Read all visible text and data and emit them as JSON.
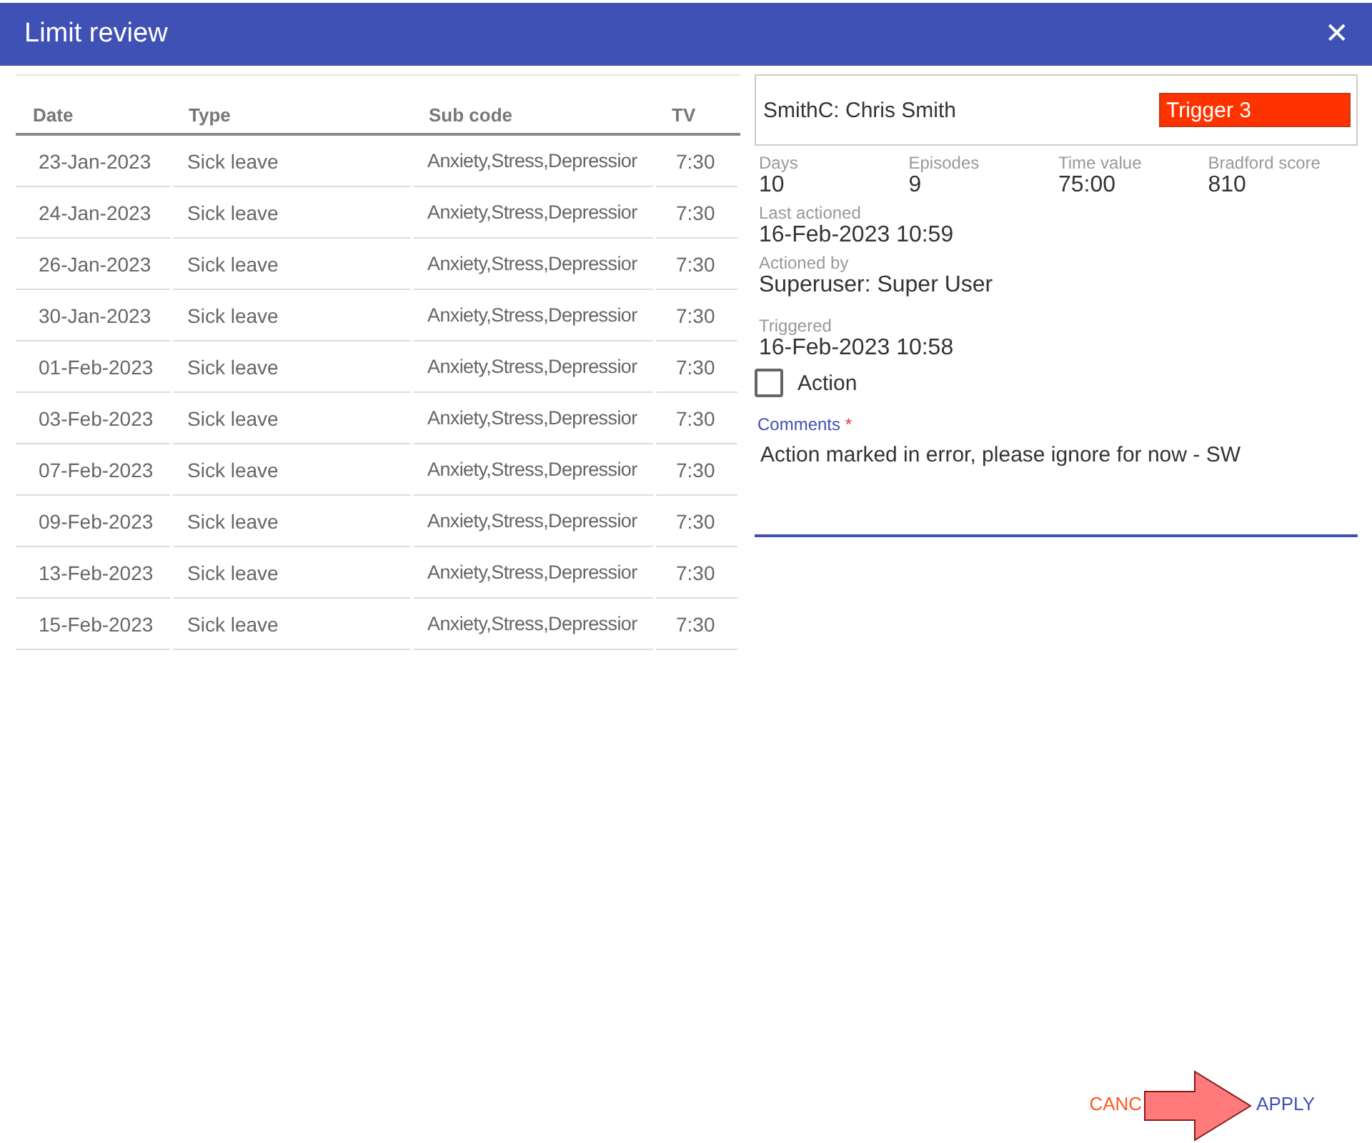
{
  "dialog": {
    "title": "Limit review",
    "close_icon": "✕"
  },
  "table": {
    "columns": [
      "Date",
      "Type",
      "Sub code",
      "TV"
    ],
    "rows": [
      [
        "23-Jan-2023",
        "Sick leave",
        "Anxiety,Stress,Depressior",
        "7:30"
      ],
      [
        "24-Jan-2023",
        "Sick leave",
        "Anxiety,Stress,Depressior",
        "7:30"
      ],
      [
        "26-Jan-2023",
        "Sick leave",
        "Anxiety,Stress,Depressior",
        "7:30"
      ],
      [
        "30-Jan-2023",
        "Sick leave",
        "Anxiety,Stress,Depressior",
        "7:30"
      ],
      [
        "01-Feb-2023",
        "Sick leave",
        "Anxiety,Stress,Depressior",
        "7:30"
      ],
      [
        "03-Feb-2023",
        "Sick leave",
        "Anxiety,Stress,Depressior",
        "7:30"
      ],
      [
        "07-Feb-2023",
        "Sick leave",
        "Anxiety,Stress,Depressior",
        "7:30"
      ],
      [
        "09-Feb-2023",
        "Sick leave",
        "Anxiety,Stress,Depressior",
        "7:30"
      ],
      [
        "13-Feb-2023",
        "Sick leave",
        "Anxiety,Stress,Depressior",
        "7:30"
      ],
      [
        "15-Feb-2023",
        "Sick leave",
        "Anxiety,Stress,Depressior",
        "7:30"
      ]
    ]
  },
  "employee": {
    "name": "SmithC: Chris Smith",
    "trigger": "Trigger 3"
  },
  "stats": [
    {
      "label": "Days",
      "value": "10"
    },
    {
      "label": "Episodes",
      "value": "9"
    },
    {
      "label": "Time value",
      "value": "75:00"
    },
    {
      "label": "Bradford score",
      "value": "810"
    }
  ],
  "details": [
    {
      "label": "Last actioned",
      "value": "16-Feb-2023 10:59"
    },
    {
      "label": "Actioned by",
      "value": "Superuser: Super User"
    },
    {
      "label": "Triggered",
      "value": "16-Feb-2023 10:58"
    }
  ],
  "action": {
    "label": "Action",
    "checked": false
  },
  "comments": {
    "label": "Comments",
    "required_mark": "*",
    "value": "Action marked in error, please ignore for now - SW"
  },
  "buttons": [
    {
      "label": "CANC",
      "kind": "cancel"
    },
    {
      "label": "APPLY",
      "kind": "apply"
    }
  ]
}
